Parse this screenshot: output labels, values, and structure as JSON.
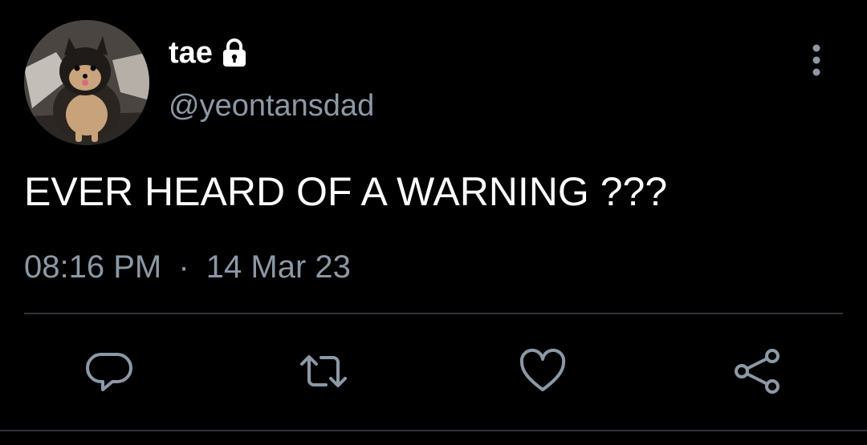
{
  "user": {
    "display_name": "tae",
    "handle": "@yeontansdad",
    "protected": true
  },
  "tweet": {
    "text": "EVER HEARD OF A WARNING ???",
    "time": "08:16 PM",
    "separator": "·",
    "date": "14 Mar 23"
  },
  "icons": {
    "lock": "lock-icon",
    "more": "more-vertical-icon",
    "reply": "reply-icon",
    "retweet": "retweet-icon",
    "like": "heart-icon",
    "share": "share-icon"
  },
  "colors": {
    "background": "#000000",
    "text_primary": "#ffffff",
    "text_secondary": "#8b98a5",
    "divider": "#2f3336"
  }
}
